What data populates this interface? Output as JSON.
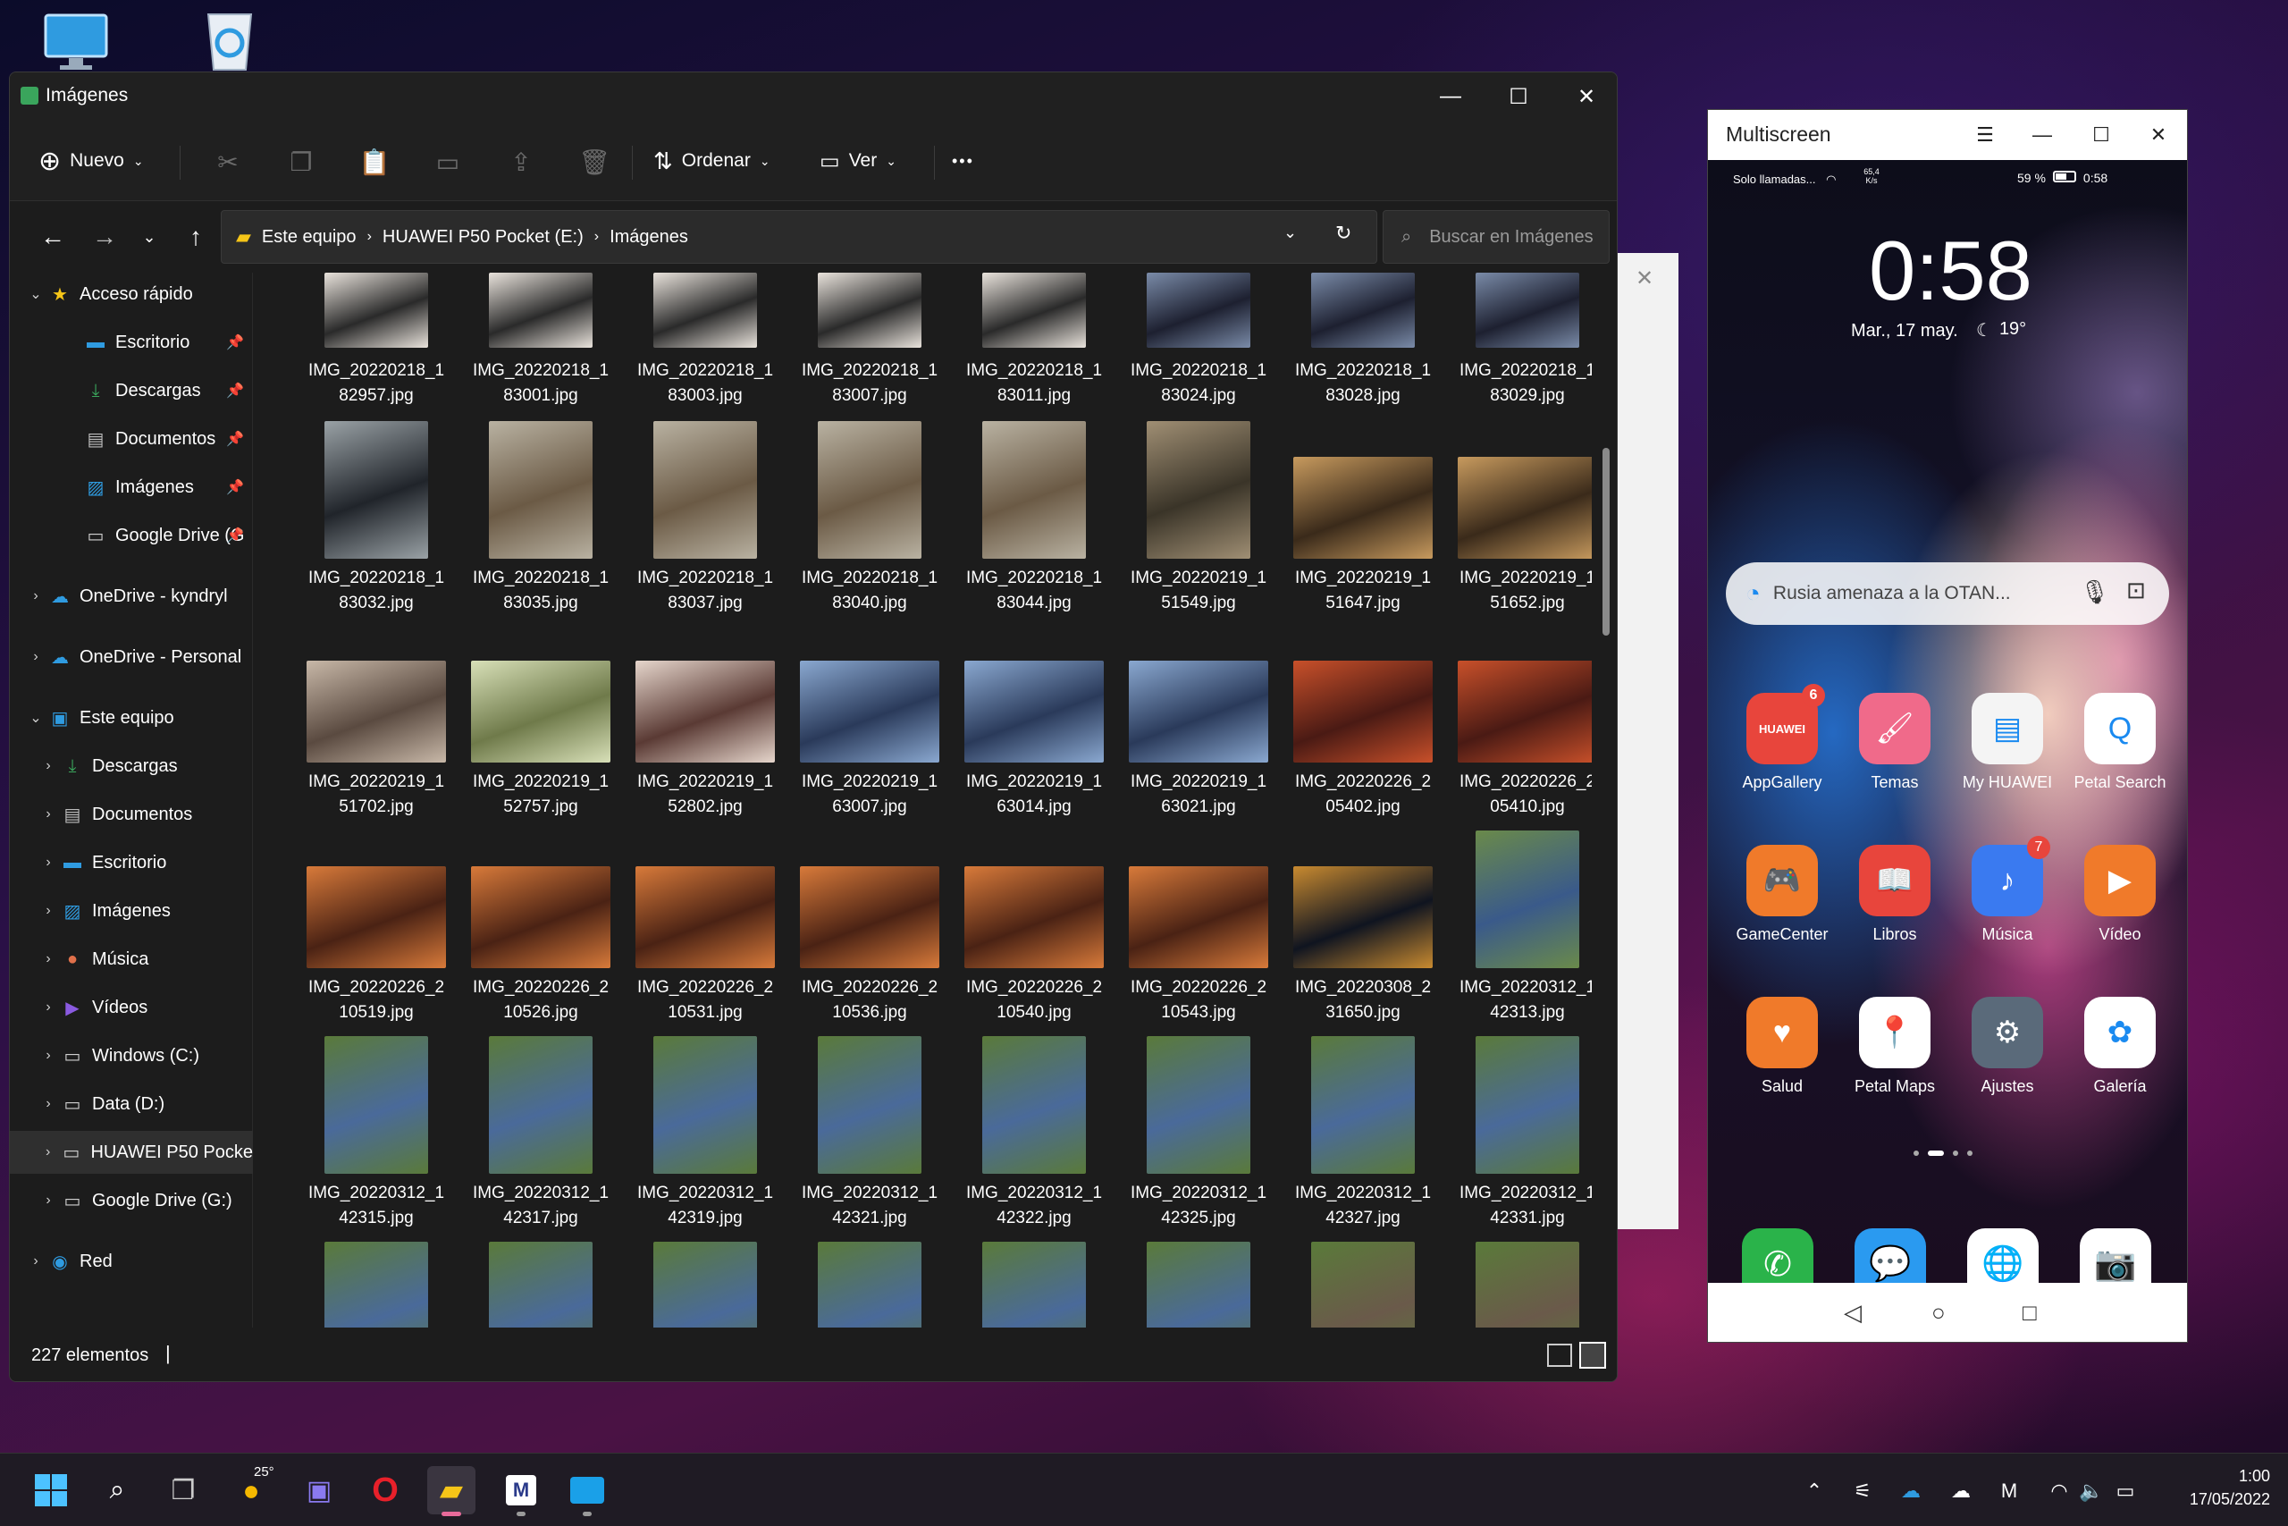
{
  "desktop": {
    "icons": [
      {
        "name": "computer-icon"
      },
      {
        "name": "recycle-bin-icon"
      }
    ]
  },
  "explorer": {
    "title": "Imágenes",
    "toolbar": {
      "new_label": "Nuevo",
      "sort_label": "Ordenar",
      "view_label": "Ver",
      "more_label": "•••"
    },
    "breadcrumb": [
      "Este equipo",
      "HUAWEI P50 Pocket (E:)",
      "Imágenes"
    ],
    "search_placeholder": "Buscar en Imágenes",
    "sidebar": [
      {
        "label": "Acceso rápido",
        "icon": "star-icon",
        "color": "#f5c518"
      },
      {
        "label": "Escritorio",
        "icon": "desktop-icon",
        "color": "#2f9be0"
      },
      {
        "label": "Descargas",
        "icon": "download-icon",
        "color": "#3aa55c"
      },
      {
        "label": "Documentos",
        "icon": "document-icon",
        "color": "#bdbdbd"
      },
      {
        "label": "Imágenes",
        "icon": "pictures-icon",
        "color": "#2f9be0"
      },
      {
        "label": "Google Drive (G",
        "icon": "drive-icon",
        "color": "#cfcfcf"
      },
      {
        "label": "OneDrive - kyndryl",
        "icon": "cloud-icon",
        "color": "#2f9be0"
      },
      {
        "label": "OneDrive - Personal",
        "icon": "cloud-icon",
        "color": "#2f9be0"
      },
      {
        "label": "Este equipo",
        "icon": "computer-icon",
        "color": "#2f9be0"
      },
      {
        "label": "Descargas",
        "icon": "download-icon",
        "color": "#3aa55c"
      },
      {
        "label": "Documentos",
        "icon": "document-icon",
        "color": "#bdbdbd"
      },
      {
        "label": "Escritorio",
        "icon": "desktop-icon",
        "color": "#2f9be0"
      },
      {
        "label": "Imágenes",
        "icon": "pictures-icon",
        "color": "#2f9be0"
      },
      {
        "label": "Música",
        "icon": "music-icon",
        "color": "#e0704a"
      },
      {
        "label": "Vídeos",
        "icon": "video-icon",
        "color": "#8a5ae0"
      },
      {
        "label": "Windows (C:)",
        "icon": "drive-icon",
        "color": "#cfcfcf"
      },
      {
        "label": "Data (D:)",
        "icon": "drive-icon",
        "color": "#cfcfcf"
      },
      {
        "label": "HUAWEI P50 Pocke",
        "icon": "drive-icon",
        "color": "#cfcfcf"
      },
      {
        "label": "Google Drive (G:)",
        "icon": "drive-icon",
        "color": "#cfcfcf"
      },
      {
        "label": "Red",
        "icon": "network-icon",
        "color": "#2f9be0"
      }
    ],
    "files": [
      {
        "l1": "IMG_20220218_1",
        "l2": "82957.jpg",
        "c1": "#2a2a2a",
        "c2": "#e9e3dc",
        "orient": "p"
      },
      {
        "l1": "IMG_20220218_1",
        "l2": "83001.jpg",
        "c1": "#2a2a2a",
        "c2": "#e9e3dc",
        "orient": "p"
      },
      {
        "l1": "IMG_20220218_1",
        "l2": "83003.jpg",
        "c1": "#2a2a2a",
        "c2": "#e9e3dc",
        "orient": "p"
      },
      {
        "l1": "IMG_20220218_1",
        "l2": "83007.jpg",
        "c1": "#2a2a2a",
        "c2": "#e9e3dc",
        "orient": "p"
      },
      {
        "l1": "IMG_20220218_1",
        "l2": "83011.jpg",
        "c1": "#2a2a2a",
        "c2": "#e9e3dc",
        "orient": "p"
      },
      {
        "l1": "IMG_20220218_1",
        "l2": "83024.jpg",
        "c1": "#1d2030",
        "c2": "#7a8ba8",
        "orient": "p"
      },
      {
        "l1": "IMG_20220218_1",
        "l2": "83028.jpg",
        "c1": "#1d2030",
        "c2": "#7a8ba8",
        "orient": "p"
      },
      {
        "l1": "IMG_20220218_1",
        "l2": "83029.jpg",
        "c1": "#1d2030",
        "c2": "#7a8ba8",
        "orient": "p"
      },
      {
        "l1": "IMG_20220218_1",
        "l2": "83032.jpg",
        "c1": "#20242a",
        "c2": "#9aa2a6",
        "orient": "p"
      },
      {
        "l1": "IMG_20220218_1",
        "l2": "83035.jpg",
        "c1": "#6b5a45",
        "c2": "#b9b2a2",
        "orient": "p"
      },
      {
        "l1": "IMG_20220218_1",
        "l2": "83037.jpg",
        "c1": "#6b5a45",
        "c2": "#b9b2a2",
        "orient": "p"
      },
      {
        "l1": "IMG_20220218_1",
        "l2": "83040.jpg",
        "c1": "#6b5a45",
        "c2": "#b9b2a2",
        "orient": "p"
      },
      {
        "l1": "IMG_20220218_1",
        "l2": "83044.jpg",
        "c1": "#6b5a45",
        "c2": "#b9b2a2",
        "orient": "p"
      },
      {
        "l1": "IMG_20220219_1",
        "l2": "51549.jpg",
        "c1": "#3a3428",
        "c2": "#a08f74",
        "orient": "p"
      },
      {
        "l1": "IMG_20220219_1",
        "l2": "51647.jpg",
        "c1": "#3a2a1a",
        "c2": "#c79a5e",
        "orient": "l"
      },
      {
        "l1": "IMG_20220219_1",
        "l2": "51652.jpg",
        "c1": "#3a2a1a",
        "c2": "#c79a5e",
        "orient": "l"
      },
      {
        "l1": "IMG_20220219_1",
        "l2": "51702.jpg",
        "c1": "#5a4a40",
        "c2": "#c8b8a8",
        "orient": "l"
      },
      {
        "l1": "IMG_20220219_1",
        "l2": "52757.jpg",
        "c1": "#6f7a4a",
        "c2": "#d8e0b8",
        "orient": "l"
      },
      {
        "l1": "IMG_20220219_1",
        "l2": "52802.jpg",
        "c1": "#5a3a34",
        "c2": "#e6d6cc",
        "orient": "l"
      },
      {
        "l1": "IMG_20220219_1",
        "l2": "63007.jpg",
        "c1": "#2a3a5a",
        "c2": "#8aa8d0",
        "orient": "l"
      },
      {
        "l1": "IMG_20220219_1",
        "l2": "63014.jpg",
        "c1": "#2a3a5a",
        "c2": "#8aa8d0",
        "orient": "l"
      },
      {
        "l1": "IMG_20220219_1",
        "l2": "63021.jpg",
        "c1": "#2a3a5a",
        "c2": "#8aa8d0",
        "orient": "l"
      },
      {
        "l1": "IMG_20220226_2",
        "l2": "05402.jpg",
        "c1": "#4a1a14",
        "c2": "#c8502a",
        "orient": "l"
      },
      {
        "l1": "IMG_20220226_2",
        "l2": "05410.jpg",
        "c1": "#4a1a14",
        "c2": "#c8502a",
        "orient": "l"
      },
      {
        "l1": "IMG_20220226_2",
        "l2": "10519.jpg",
        "c1": "#4a2214",
        "c2": "#d87a3a",
        "orient": "l"
      },
      {
        "l1": "IMG_20220226_2",
        "l2": "10526.jpg",
        "c1": "#4a2214",
        "c2": "#d87a3a",
        "orient": "l"
      },
      {
        "l1": "IMG_20220226_2",
        "l2": "10531.jpg",
        "c1": "#4a2214",
        "c2": "#d87a3a",
        "orient": "l"
      },
      {
        "l1": "IMG_20220226_2",
        "l2": "10536.jpg",
        "c1": "#4a2214",
        "c2": "#d87a3a",
        "orient": "l"
      },
      {
        "l1": "IMG_20220226_2",
        "l2": "10540.jpg",
        "c1": "#4a2214",
        "c2": "#d87a3a",
        "orient": "l"
      },
      {
        "l1": "IMG_20220226_2",
        "l2": "10543.jpg",
        "c1": "#4a2214",
        "c2": "#d87a3a",
        "orient": "l"
      },
      {
        "l1": "IMG_20220308_2",
        "l2": "31650.jpg",
        "c1": "#0f1420",
        "c2": "#c88a30",
        "orient": "l"
      },
      {
        "l1": "IMG_20220312_1",
        "l2": "42313.jpg",
        "c1": "#3a5a8a",
        "c2": "#6a8a4a",
        "orient": "p"
      },
      {
        "l1": "IMG_20220312_1",
        "l2": "42315.jpg",
        "c1": "#4a6a9a",
        "c2": "#5a7a3a",
        "orient": "p"
      },
      {
        "l1": "IMG_20220312_1",
        "l2": "42317.jpg",
        "c1": "#4a6a9a",
        "c2": "#5a7a3a",
        "orient": "p"
      },
      {
        "l1": "IMG_20220312_1",
        "l2": "42319.jpg",
        "c1": "#4a6a9a",
        "c2": "#5a7a3a",
        "orient": "p"
      },
      {
        "l1": "IMG_20220312_1",
        "l2": "42321.jpg",
        "c1": "#4a6a9a",
        "c2": "#5a7a3a",
        "orient": "p"
      },
      {
        "l1": "IMG_20220312_1",
        "l2": "42322.jpg",
        "c1": "#4a6a9a",
        "c2": "#5a7a3a",
        "orient": "p"
      },
      {
        "l1": "IMG_20220312_1",
        "l2": "42325.jpg",
        "c1": "#4a6a9a",
        "c2": "#5a7a3a",
        "orient": "p"
      },
      {
        "l1": "IMG_20220312_1",
        "l2": "42327.jpg",
        "c1": "#4a6a9a",
        "c2": "#5a7a3a",
        "orient": "p"
      },
      {
        "l1": "IMG_20220312_1",
        "l2": "42331.jpg",
        "c1": "#4a6a9a",
        "c2": "#5a7a3a",
        "orient": "p"
      },
      {
        "l1": "",
        "l2": "",
        "c1": "#4a6a9a",
        "c2": "#5a7a3a",
        "orient": "p"
      },
      {
        "l1": "",
        "l2": "",
        "c1": "#4a6a9a",
        "c2": "#5a7a3a",
        "orient": "p"
      },
      {
        "l1": "",
        "l2": "",
        "c1": "#4a6a9a",
        "c2": "#5a7a3a",
        "orient": "p"
      },
      {
        "l1": "",
        "l2": "",
        "c1": "#4a6a9a",
        "c2": "#5a7a3a",
        "orient": "p"
      },
      {
        "l1": "",
        "l2": "",
        "c1": "#4a6a9a",
        "c2": "#5a7a3a",
        "orient": "p"
      },
      {
        "l1": "",
        "l2": "",
        "c1": "#4a6a9a",
        "c2": "#5a7a3a",
        "orient": "p"
      },
      {
        "l1": "",
        "l2": "",
        "c1": "#6a5a4a",
        "c2": "#5a7a3a",
        "orient": "p"
      },
      {
        "l1": "",
        "l2": "",
        "c1": "#6a5a4a",
        "c2": "#5a7a3a",
        "orient": "p"
      }
    ],
    "status": "227 elementos"
  },
  "multiscreen": {
    "title": "Multiscreen",
    "statusbar_left": "Solo llamadas...",
    "statusbar_speed": "65,4 K/s",
    "battery": "59 %",
    "statusbar_time": "0:58",
    "clock": "0:58",
    "date": "Mar., 17 may.",
    "weather": "19°",
    "search_text": "Rusia amenaza a la OTAN...",
    "apps": [
      {
        "label": "AppGallery",
        "icon": "appgallery-icon",
        "bg": "#e8453c",
        "glyph": "HUAWEI",
        "badge": "6"
      },
      {
        "label": "Temas",
        "icon": "themes-icon",
        "bg": "#f06a8a",
        "glyph": "🖌",
        "badge": ""
      },
      {
        "label": "My HUAWEI",
        "icon": "my-huawei-icon",
        "bg": "#f4f4f4",
        "glyph": "▤",
        "badge": ""
      },
      {
        "label": "Petal Search",
        "icon": "petal-search-icon",
        "bg": "#ffffff",
        "glyph": "Q",
        "badge": ""
      },
      {
        "label": "GameCenter",
        "icon": "gamecenter-icon",
        "bg": "#f07a2a",
        "glyph": "🎮",
        "badge": ""
      },
      {
        "label": "Libros",
        "icon": "books-icon",
        "bg": "#e8453c",
        "glyph": "📖",
        "badge": ""
      },
      {
        "label": "Música",
        "icon": "music-icon",
        "bg": "#3a7af0",
        "glyph": "♪",
        "badge": "7"
      },
      {
        "label": "Vídeo",
        "icon": "video-icon",
        "bg": "#f07a2a",
        "glyph": "▶",
        "badge": ""
      },
      {
        "label": "Salud",
        "icon": "health-icon",
        "bg": "#f07a2a",
        "glyph": "♥",
        "badge": ""
      },
      {
        "label": "Petal Maps",
        "icon": "petal-maps-icon",
        "bg": "#ffffff",
        "glyph": "📍",
        "badge": ""
      },
      {
        "label": "Ajustes",
        "icon": "settings-icon",
        "bg": "#5a6a7a",
        "glyph": "⚙",
        "badge": ""
      },
      {
        "label": "Galería",
        "icon": "gallery-icon",
        "bg": "#ffffff",
        "glyph": "✿",
        "badge": ""
      }
    ],
    "dock": [
      {
        "icon": "phone-icon",
        "bg": "#2ab34a",
        "glyph": "✆"
      },
      {
        "icon": "messages-icon",
        "bg": "#2a9af0",
        "glyph": "💬"
      },
      {
        "icon": "browser-icon",
        "bg": "#ffffff",
        "glyph": "🌐"
      },
      {
        "icon": "camera-icon",
        "bg": "#ffffff",
        "glyph": "📷"
      }
    ]
  },
  "taskbar": {
    "weather_temp": "25°",
    "time": "1:00",
    "date": "17/05/2022"
  }
}
